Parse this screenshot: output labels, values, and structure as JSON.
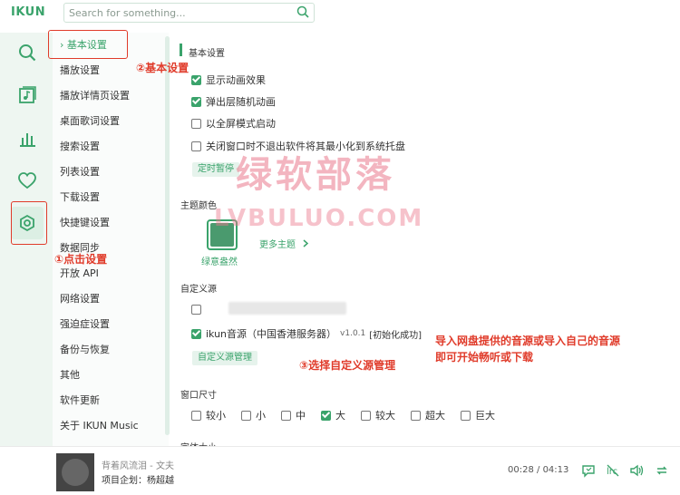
{
  "app": {
    "logo": "IKUN"
  },
  "search": {
    "placeholder": "Search for something..."
  },
  "categories": [
    "› 基本设置",
    "播放设置",
    "播放详情页设置",
    "桌面歌词设置",
    "搜索设置",
    "列表设置",
    "下载设置",
    "快捷键设置",
    "数据同步",
    "开放 API",
    "网络设置",
    "强迫症设置",
    "备份与恢复",
    "其他",
    "软件更新",
    "关于 IKUN Music"
  ],
  "basic": {
    "title": "基本设置",
    "options": [
      {
        "label": "显示动画效果",
        "checked": true
      },
      {
        "label": "弹出层随机动画",
        "checked": true
      },
      {
        "label": "以全屏模式启动",
        "checked": false
      },
      {
        "label": "关闭窗口时不退出软件将其最小化到系统托盘",
        "checked": false
      }
    ],
    "timer_button": "定时暂停"
  },
  "theme": {
    "title": "主题颜色",
    "current": "绿意盎然",
    "more": "更多主题"
  },
  "custom_source": {
    "title": "自定义源",
    "source_label": "ikun音源（中国香港服务器）",
    "source_version": "v1.0.1",
    "source_status": "[初始化成功]",
    "manage_button": "自定义源管理"
  },
  "window_size": {
    "title": "窗口尺寸",
    "options": [
      {
        "label": "较小",
        "checked": false
      },
      {
        "label": "小",
        "checked": false
      },
      {
        "label": "中",
        "checked": false
      },
      {
        "label": "大",
        "checked": true
      },
      {
        "label": "较大",
        "checked": false
      },
      {
        "label": "超大",
        "checked": false
      },
      {
        "label": "巨大",
        "checked": false
      }
    ]
  },
  "font_size": {
    "title": "字体大小"
  },
  "annotations": {
    "step1": "①点击设置",
    "step2": "②基本设置",
    "step3": "③选择自定义源管理",
    "tip_line1": "导入网盘提供的音源或导入自己的音源",
    "tip_line2": "即可开始畅听或下载"
  },
  "watermark": {
    "main": "绿软部落",
    "sub": "LVBULUO.COM"
  },
  "player": {
    "song": "背着风流泪 - 文夫",
    "credit": "项目企划：杨超越",
    "current_time": "00:28",
    "total_time": "04:13"
  },
  "colors": {
    "accent": "#3aa36b",
    "annotation": "#e03b2a"
  }
}
